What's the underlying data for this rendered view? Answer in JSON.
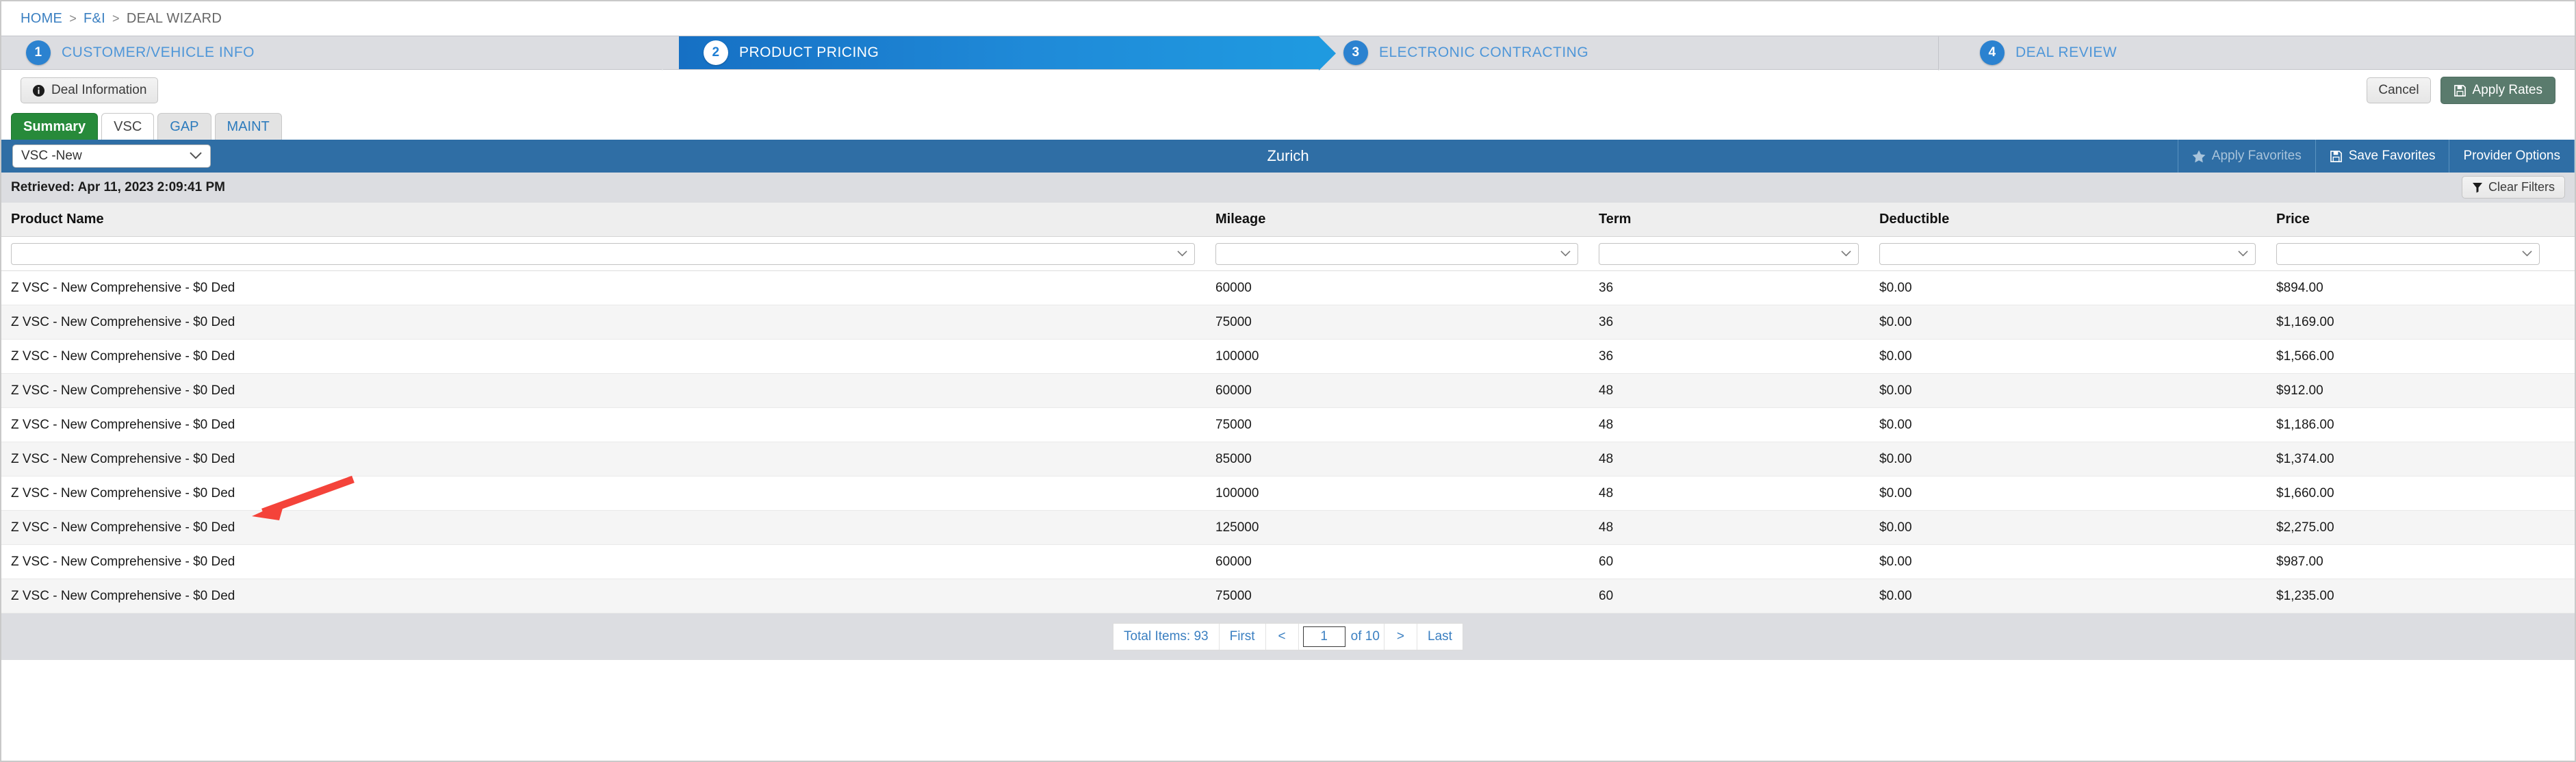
{
  "breadcrumb": {
    "items": [
      {
        "label": "HOME",
        "type": "link"
      },
      {
        "label": "F&I",
        "type": "link"
      },
      {
        "label": "DEAL WIZARD",
        "type": "current"
      }
    ],
    "separator": ">"
  },
  "wizard": {
    "steps": [
      {
        "number": "1",
        "label": "CUSTOMER/VEHICLE INFO",
        "state": "complete"
      },
      {
        "number": "2",
        "label": "PRODUCT PRICING",
        "state": "active"
      },
      {
        "number": "3",
        "label": "ELECTRONIC CONTRACTING",
        "state": "inactive"
      },
      {
        "number": "4",
        "label": "DEAL REVIEW",
        "state": "inactive"
      }
    ]
  },
  "toolbar": {
    "deal_information_label": "Deal Information",
    "deal_information_icon": "info-circle-icon",
    "cancel_label": "Cancel",
    "apply_rates_label": "Apply Rates",
    "apply_rates_icon": "save-icon"
  },
  "tabs": [
    {
      "label": "Summary",
      "state": "active"
    },
    {
      "label": "VSC",
      "state": "white"
    },
    {
      "label": "GAP",
      "state": "normal"
    },
    {
      "label": "MAINT",
      "state": "normal"
    }
  ],
  "provider_bar": {
    "product_select_value": "VSC -New",
    "title": "Zurich",
    "apply_favorites_label": "Apply Favorites",
    "apply_favorites_icon": "star-icon",
    "save_favorites_label": "Save Favorites",
    "save_favorites_icon": "save-icon",
    "provider_options_label": "Provider Options"
  },
  "retrieved": {
    "text": "Retrieved: Apr 11, 2023 2:09:41 PM",
    "clear_filters_label": "Clear Filters",
    "clear_filters_icon": "filter-icon"
  },
  "grid": {
    "columns": [
      "Product Name",
      "Mileage",
      "Term",
      "Deductible",
      "Price"
    ],
    "filter_values": [
      "",
      "",
      "",
      "",
      ""
    ],
    "rows": [
      {
        "product": "Z VSC - New Comprehensive - $0 Ded",
        "mileage": "60000",
        "term": "36",
        "deductible": "$0.00",
        "price": "$894.00"
      },
      {
        "product": "Z VSC - New Comprehensive - $0 Ded",
        "mileage": "75000",
        "term": "36",
        "deductible": "$0.00",
        "price": "$1,169.00"
      },
      {
        "product": "Z VSC - New Comprehensive - $0 Ded",
        "mileage": "100000",
        "term": "36",
        "deductible": "$0.00",
        "price": "$1,566.00"
      },
      {
        "product": "Z VSC - New Comprehensive - $0 Ded",
        "mileage": "60000",
        "term": "48",
        "deductible": "$0.00",
        "price": "$912.00"
      },
      {
        "product": "Z VSC - New Comprehensive - $0 Ded",
        "mileage": "75000",
        "term": "48",
        "deductible": "$0.00",
        "price": "$1,186.00"
      },
      {
        "product": "Z VSC - New Comprehensive - $0 Ded",
        "mileage": "85000",
        "term": "48",
        "deductible": "$0.00",
        "price": "$1,374.00"
      },
      {
        "product": "Z VSC - New Comprehensive - $0 Ded",
        "mileage": "100000",
        "term": "48",
        "deductible": "$0.00",
        "price": "$1,660.00"
      },
      {
        "product": "Z VSC - New Comprehensive - $0 Ded",
        "mileage": "125000",
        "term": "48",
        "deductible": "$0.00",
        "price": "$2,275.00"
      },
      {
        "product": "Z VSC - New Comprehensive - $0 Ded",
        "mileage": "60000",
        "term": "60",
        "deductible": "$0.00",
        "price": "$987.00"
      },
      {
        "product": "Z VSC - New Comprehensive - $0 Ded",
        "mileage": "75000",
        "term": "60",
        "deductible": "$0.00",
        "price": "$1,235.00"
      }
    ]
  },
  "pagination": {
    "total_items_label": "Total Items: 93",
    "first_label": "First",
    "prev_label": "<",
    "current_page": "1",
    "of_label": "of 10",
    "next_label": ">",
    "last_label": "Last"
  },
  "annotation": {
    "arrow_color": "#f4433a"
  },
  "colors": {
    "wizard_active_blue": "#1f8ad8",
    "provider_bar_blue": "#2f6ea5",
    "tab_active_green": "#278a3a",
    "apply_rates_green": "#5a7b6d",
    "link_blue": "#3a7fc1"
  }
}
